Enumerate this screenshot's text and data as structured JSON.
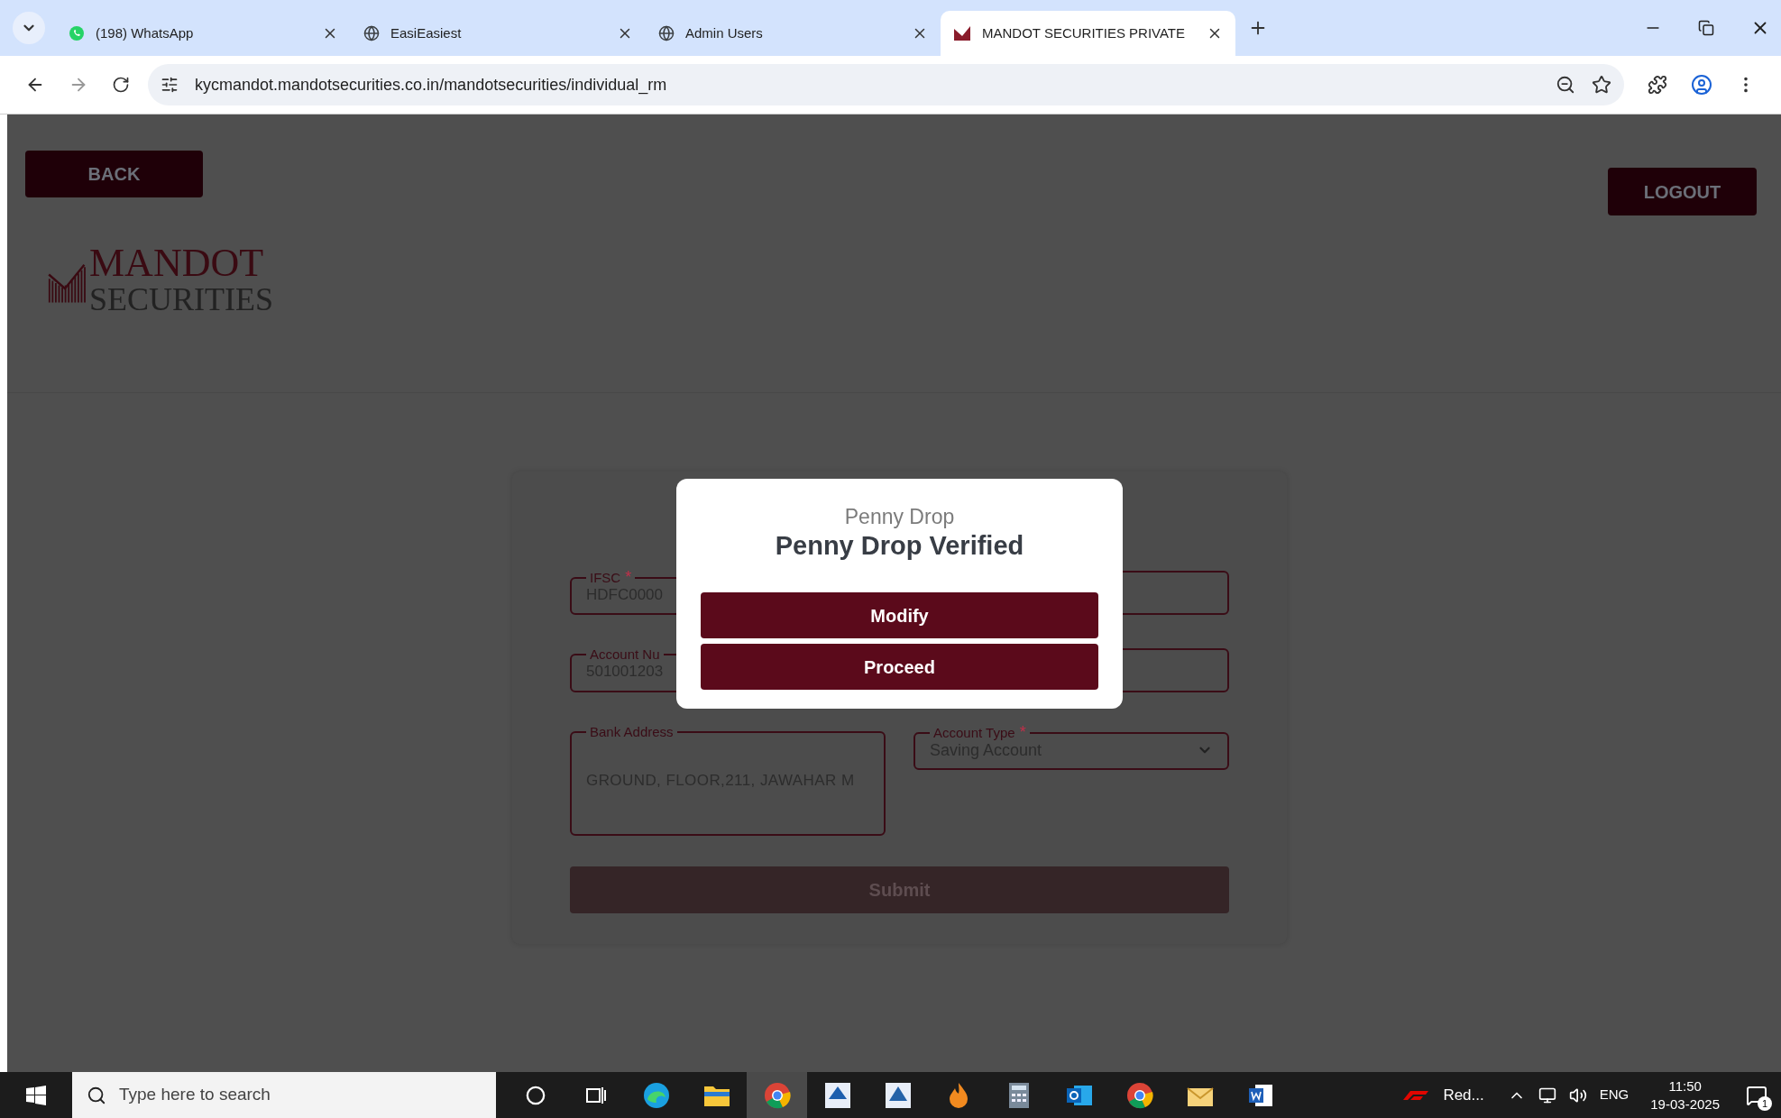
{
  "browser": {
    "tabs": [
      {
        "title": "(198) WhatsApp",
        "kind": "whatsapp",
        "selected": false
      },
      {
        "title": "EasiEasiest",
        "kind": "globe",
        "selected": false
      },
      {
        "title": "Admin Users",
        "kind": "globe",
        "selected": false
      },
      {
        "title": "MANDOT SECURITIES PRIVATE",
        "kind": "logo",
        "selected": true
      }
    ],
    "url": "kycmandot.mandotsecurities.co.in/mandotsecurities/individual_rm"
  },
  "page": {
    "back_button": "BACK",
    "logout_button": "LOGOUT",
    "logo": {
      "line1": "MANDOT",
      "line2": "SECURITIES"
    }
  },
  "form": {
    "fields": [
      {
        "kind": "text",
        "label": "IFSC",
        "required_mark": "*",
        "value": "HDFC0000"
      },
      {
        "kind": "text"
      },
      {
        "kind": "text",
        "label": "Account Nu",
        "value": "501001203"
      },
      {
        "kind": "text"
      },
      {
        "kind": "textarea",
        "label": "Bank Address",
        "value": "GROUND, FLOOR,211, JAWAHAR M"
      },
      {
        "kind": "select",
        "label": "Account Type",
        "required_mark": "*",
        "value": "Saving Account"
      }
    ],
    "submit": {
      "label": "Submit",
      "disabled": true
    }
  },
  "modal": {
    "subtitle": "Penny Drop",
    "title": "Penny Drop Verified",
    "buttons": [
      "Modify",
      "Proceed"
    ]
  },
  "taskbar": {
    "search_placeholder": "Type here to search",
    "apps": [
      {
        "kind": "cortana",
        "selected": false
      },
      {
        "kind": "taskview",
        "selected": false
      },
      {
        "kind": "edge",
        "selected": false
      },
      {
        "kind": "explorer",
        "selected": false
      },
      {
        "kind": "chrome",
        "selected": true
      },
      {
        "kind": "cdsl",
        "selected": false
      },
      {
        "kind": "capex",
        "selected": false
      },
      {
        "kind": "flame",
        "selected": false
      },
      {
        "kind": "calculator",
        "selected": false
      },
      {
        "kind": "outlook",
        "selected": false
      },
      {
        "kind": "chrome",
        "selected": false
      },
      {
        "kind": "mail",
        "selected": false
      },
      {
        "kind": "word",
        "selected": false
      }
    ],
    "tray_app": "Red...",
    "language": "ENG",
    "time": "11:50",
    "date": "19-03-2025",
    "notifications": "1"
  }
}
